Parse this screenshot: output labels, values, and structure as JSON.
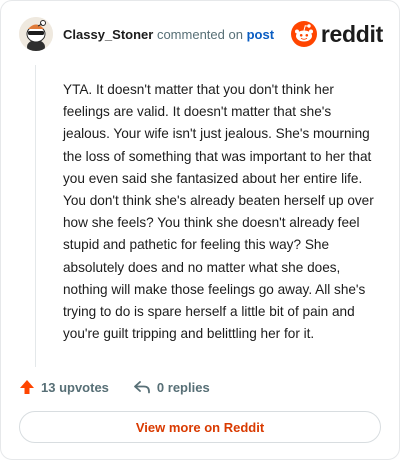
{
  "header": {
    "username": "Classy_Stoner",
    "action_text": "commented on",
    "post_link": "post",
    "brand": "reddit",
    "brand_color": "#ff4500",
    "avatar_icon": "snoo-avatar-icon"
  },
  "comment": {
    "text": "YTA. It doesn't matter that you don't think her feelings are valid. It doesn't matter that she's jealous. Your wife isn't just jealous. She's mourning the loss of something that was important to her that you even said she fantasized about her entire life. You don't think she's already beaten herself up over how she feels? You think she doesn't already feel stupid and pathetic for feeling this way? She absolutely does and no matter what she does, nothing will make those feelings go away. All she's trying to do is spare herself a little bit of pain and you're guilt tripping and belittling her for it."
  },
  "actions": {
    "upvotes": "13 upvotes",
    "upvote_icon": "upvote-arrow-icon",
    "upvote_color": "#ff4500",
    "replies": "0 replies",
    "reply_icon": "reply-arrow-icon"
  },
  "footer": {
    "view_more": "View more on Reddit",
    "link_color": "#d93a00"
  }
}
